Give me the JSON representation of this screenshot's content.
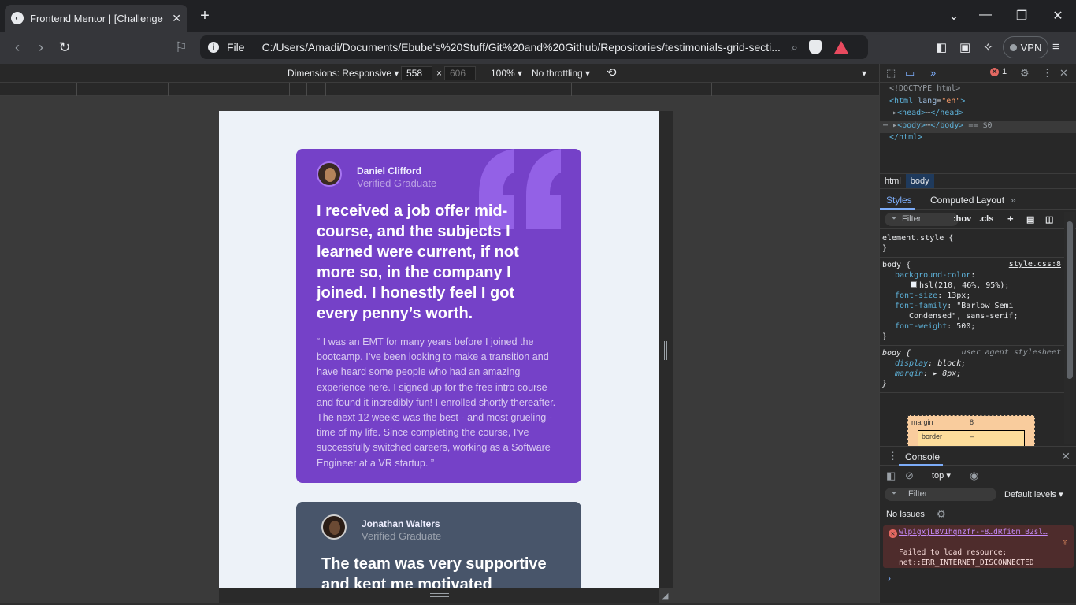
{
  "browser": {
    "tab_title": "Frontend Mentor | [Challenge N",
    "tab_close": "✕",
    "new_tab": "+",
    "url_scheme": "File",
    "url": "C:/Users/Amadi/Documents/Ebube's%20Stuff/Git%20and%20Github/Repositories/testimonials-grid-secti...",
    "vpn_label": "VPN"
  },
  "device_toolbar": {
    "dimensions_label": "Dimensions: Responsive ▾",
    "width": "558",
    "times": "×",
    "height": "606",
    "zoom": "100% ▾",
    "throttling": "No throttling ▾"
  },
  "testimonials": [
    {
      "name": "Daniel Clifford",
      "role": "Verified Graduate",
      "headline": "I received a job offer mid-course, and the subjects I learned were current, if not more so, in the company I joined. I honestly feel I got every penny’s worth.",
      "body": "“ I was an EMT for many years before I joined the bootcamp. I’ve been looking to make a transition and have heard some people who had an amazing experience here. I signed up for the free intro course and found it incredibly fun! I enrolled shortly thereafter. The next 12 weeks was the best - and most grueling - time of my life. Since completing the course, I’ve successfully switched careers, working as a Software Engineer at a VR startup. ”",
      "color": "#7541c8"
    },
    {
      "name": "Jonathan Walters",
      "role": "Verified Graduate",
      "headline": "The team was very supportive and kept me motivated",
      "color": "#48556a"
    }
  ],
  "devtools": {
    "error_count": "1",
    "dom": {
      "doctype": "<!DOCTYPE html>",
      "html_open": "<html",
      "lang_attr": "lang",
      "lang_val": "\"en\"",
      "html_close_bracket": ">",
      "head": "<head>",
      "head_close": "</head>",
      "body": "<body>",
      "body_close": "</body>",
      "body_marker": "== $0",
      "html_end": "</html>",
      "ellipsis": "⋯"
    },
    "breadcrumbs": [
      "html",
      "body"
    ],
    "panel_tabs": [
      "Styles",
      "Computed",
      "Layout"
    ],
    "filter_placeholder": "Filter",
    "hov": ":hov",
    "cls": ".cls",
    "styles": {
      "element_style": "element.style {",
      "close_brace": "}",
      "body_selector": "body {",
      "source": "style.css:8",
      "bg_prop": "background-color",
      "bg_val": "hsl(210, 46%, 95%);",
      "fs_prop": "font-size",
      "fs_val": "13px;",
      "ff_prop": "font-family",
      "ff_val1": "\"Barlow Semi",
      "ff_val2": "Condensed\", sans-serif;",
      "fw_prop": "font-weight",
      "fw_val": "500;",
      "ua_selector": "body {",
      "ua_label": "user agent stylesheet",
      "display_prop": "display",
      "display_val": "block;",
      "margin_prop": "margin",
      "margin_val": "8px;"
    },
    "boxmodel": {
      "margin_label": "margin",
      "margin_value": "8",
      "border_label": "border",
      "border_value": "–"
    },
    "console": {
      "tab": "Console",
      "context": "top ▾",
      "filter_placeholder": "Filter",
      "levels": "Default levels ▾",
      "issues": "No Issues",
      "error_link": "wlpigxjLBV1hqnzfr-F8…dRfi6m_B2sl…",
      "error_text": "Failed to load resource: net::ERR_INTERNET_DISCONNECTED",
      "prompt": "›"
    }
  }
}
